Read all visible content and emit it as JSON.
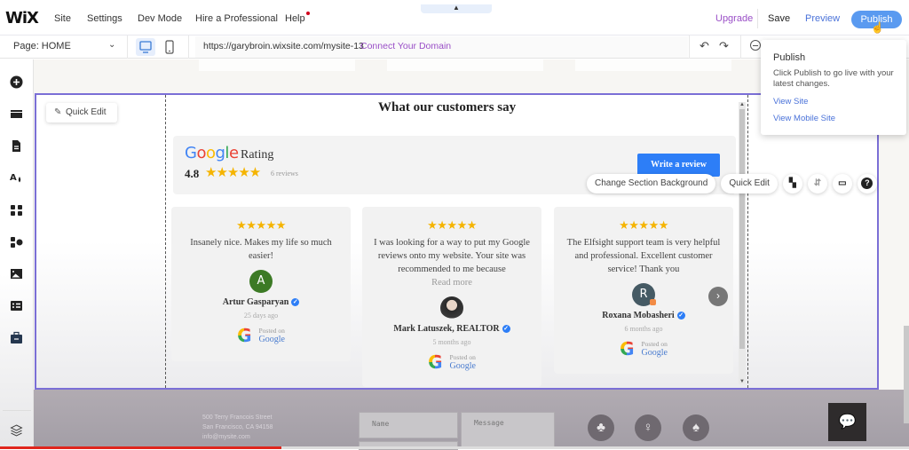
{
  "topbar": {
    "logo": "WiX",
    "menu": [
      "Site",
      "Settings",
      "Dev Mode",
      "Hire a Professional",
      "Help"
    ],
    "collapse_icon": "chevron-up-icon",
    "upgrade": "Upgrade",
    "save": "Save",
    "preview": "Preview",
    "publish": "Publish"
  },
  "secondbar": {
    "page_label": "Page: HOME",
    "url": "https://garybroin.wixsite.com/mysite-13",
    "connect_domain": "Connect Your Domain"
  },
  "publish_popover": {
    "title": "Publish",
    "description": "Click Publish to go live with your latest changes.",
    "view_site": "View Site",
    "view_mobile_site": "View Mobile Site"
  },
  "leftbar": {
    "items": [
      "add-elements",
      "add-section",
      "pages-menu",
      "site-design",
      "add-apps",
      "business-apps",
      "media-manager",
      "cms",
      "portfolio"
    ],
    "bottom": "layers"
  },
  "section": {
    "quick_edit": "Quick Edit",
    "toolbar": {
      "change_bg": "Change Section Background",
      "quick_edit": "Quick Edit"
    }
  },
  "widget": {
    "title": "What our customers say",
    "google": "Google",
    "rating_label": "Rating",
    "score": "4.8",
    "stars": "★★★★★",
    "review_count": "6 reviews",
    "write_review": "Write a review",
    "brand_colors": {
      "blue": "#4285f4",
      "red": "#ea4335",
      "yellow": "#fbbc05",
      "green": "#34a853"
    },
    "reviews": [
      {
        "stars": "★★★★★",
        "text": "Insanely nice. Makes my life so much easier!",
        "read_more": "",
        "avatar_letter": "A",
        "avatar_color": "#3c7a25",
        "name": "Artur Gasparyan",
        "time": "25 days ago",
        "posted_on": "Posted on",
        "source": "Google"
      },
      {
        "stars": "★★★★★",
        "text": "I was looking for a way to put my Google reviews onto my website. Your site was recommended to me because",
        "read_more": "Read more",
        "avatar_letter": "",
        "avatar_color": "#3a3a3a",
        "name": "Mark Latuszek, REALTOR",
        "time": "5 months ago",
        "posted_on": "Posted on",
        "source": "Google"
      },
      {
        "stars": "★★★★★",
        "text": "The Elfsight support team is very helpful and professional. Excellent customer service! Thank you",
        "read_more": "",
        "avatar_letter": "R",
        "avatar_color": "#455a64",
        "name": "Roxana Mobasheri",
        "time": "6 months ago",
        "posted_on": "Posted on",
        "source": "Google"
      }
    ]
  },
  "footer": {
    "address_lines": [
      "500 Terry Francois Street",
      "San Francisco, CA 94158",
      "info@mysite.com"
    ],
    "name_placeholder": "Name",
    "message_placeholder": "Message",
    "social_icons": [
      "pineapple-icon",
      "hot-air-balloon-icon",
      "palm-tree-icon"
    ]
  },
  "video_progress": 0.31
}
